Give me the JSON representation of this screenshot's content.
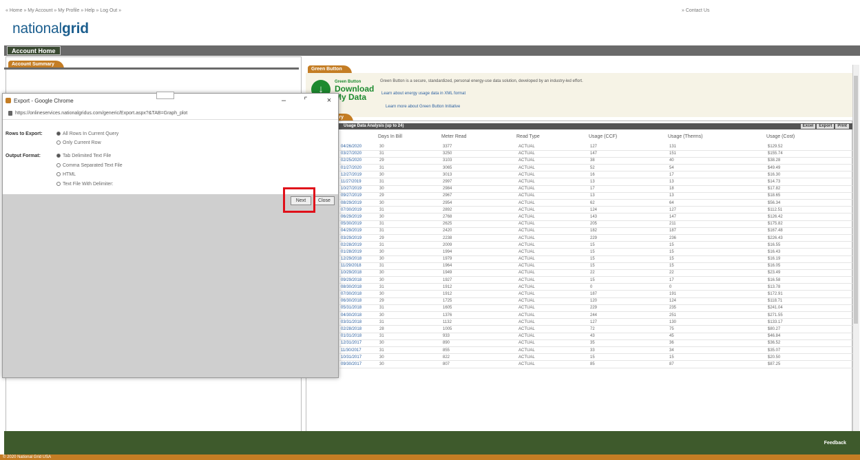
{
  "header": {
    "breadcrumb": "« Home » My Account » My Profile » Help » Log Out »",
    "contact": "» Contact Us",
    "logo_light": "national",
    "logo_bold": "grid"
  },
  "nav": {
    "account_home": "Account Home"
  },
  "account_summary": {
    "tab": "Account Summary"
  },
  "green_button": {
    "tab": "Green Button",
    "icon": "download-arrow-icon",
    "small_label": "Green Button",
    "title_1": "Download",
    "title_2": "My Data",
    "desc": "Green Button is a secure, standardized, personal energy-use data solution, developed by an industry-led effort.",
    "link_1": "Learn about energy usage data in XML format",
    "link_2": "Learn more about Green Button Initiative"
  },
  "usage": {
    "tab": "Usage History",
    "bar_title": "Usage Data Analysis (up to 24)",
    "buttons": [
      "Excel",
      "Export",
      "Print"
    ],
    "columns": [
      "Days In Bill",
      "Meter Read",
      "Read Type",
      "Usage (CCF)",
      "Usage (Therms)",
      "Usage (Cost)"
    ],
    "rows": [
      [
        "04/26/2020",
        "30",
        "3377",
        "ACTUAL",
        "127",
        "131",
        "$129.52"
      ],
      [
        "03/27/2020",
        "31",
        "3250",
        "ACTUAL",
        "147",
        "151",
        "$155.74"
      ],
      [
        "02/25/2020",
        "29",
        "3103",
        "ACTUAL",
        "38",
        "40",
        "$38.28"
      ],
      [
        "01/27/2020",
        "31",
        "3065",
        "ACTUAL",
        "52",
        "54",
        "$49.49"
      ],
      [
        "12/27/2019",
        "30",
        "3013",
        "ACTUAL",
        "16",
        "17",
        "$16.30"
      ],
      [
        "11/27/2019",
        "31",
        "2997",
        "ACTUAL",
        "13",
        "13",
        "$14.73"
      ],
      [
        "10/27/2019",
        "30",
        "2984",
        "ACTUAL",
        "17",
        "18",
        "$17.82"
      ],
      [
        "09/27/2019",
        "29",
        "2967",
        "ACTUAL",
        "13",
        "13",
        "$18.65"
      ],
      [
        "08/29/2019",
        "30",
        "2954",
        "ACTUAL",
        "62",
        "64",
        "$56.34"
      ],
      [
        "07/30/2019",
        "31",
        "2892",
        "ACTUAL",
        "124",
        "127",
        "$112.51"
      ],
      [
        "06/29/2019",
        "30",
        "2768",
        "ACTUAL",
        "143",
        "147",
        "$126.42"
      ],
      [
        "05/30/2019",
        "31",
        "2625",
        "ACTUAL",
        "205",
        "211",
        "$175.82"
      ],
      [
        "04/29/2019",
        "31",
        "2420",
        "ACTUAL",
        "182",
        "187",
        "$167.48"
      ],
      [
        "03/29/2019",
        "29",
        "2238",
        "ACTUAL",
        "229",
        "236",
        "$226.43"
      ],
      [
        "02/28/2019",
        "31",
        "2009",
        "ACTUAL",
        "15",
        "15",
        "$16.55"
      ],
      [
        "01/28/2019",
        "30",
        "1994",
        "ACTUAL",
        "15",
        "15",
        "$16.43"
      ],
      [
        "12/29/2018",
        "30",
        "1979",
        "ACTUAL",
        "15",
        "15",
        "$16.19"
      ],
      [
        "11/29/2018",
        "31",
        "1964",
        "ACTUAL",
        "15",
        "15",
        "$16.05"
      ],
      [
        "10/29/2018",
        "30",
        "1949",
        "ACTUAL",
        "22",
        "22",
        "$23.49"
      ],
      [
        "09/29/2018",
        "30",
        "1927",
        "ACTUAL",
        "15",
        "17",
        "$16.58"
      ],
      [
        "08/30/2018",
        "31",
        "1912",
        "ACTUAL",
        "0",
        "0",
        "$13.78"
      ],
      [
        "07/30/2018",
        "30",
        "1912",
        "ACTUAL",
        "187",
        "191",
        "$172.91"
      ],
      [
        "06/30/2018",
        "29",
        "1725",
        "ACTUAL",
        "120",
        "124",
        "$118.71"
      ],
      [
        "05/31/2018",
        "31",
        "1605",
        "ACTUAL",
        "229",
        "235",
        "$241.04"
      ],
      [
        "04/30/2018",
        "30",
        "1376",
        "ACTUAL",
        "244",
        "251",
        "$271.55"
      ],
      [
        "03/31/2018",
        "31",
        "1132",
        "ACTUAL",
        "127",
        "130",
        "$133.17"
      ],
      [
        "02/28/2018",
        "28",
        "1005",
        "ACTUAL",
        "72",
        "75",
        "$80.27"
      ],
      [
        "01/31/2018",
        "31",
        "933",
        "ACTUAL",
        "43",
        "45",
        "$46.84"
      ],
      [
        "12/31/2017",
        "30",
        "890",
        "ACTUAL",
        "35",
        "36",
        "$36.52"
      ],
      [
        "11/30/2017",
        "31",
        "855",
        "ACTUAL",
        "33",
        "34",
        "$35.07"
      ],
      [
        "10/31/2017",
        "30",
        "822",
        "ACTUAL",
        "15",
        "15",
        "$20.50"
      ],
      [
        "09/30/2017",
        "30",
        "807",
        "ACTUAL",
        "85",
        "87",
        "$87.25"
      ]
    ]
  },
  "popup": {
    "title": "Export - Google Chrome",
    "url": "https://onlineservices.nationalgridus.com/generic/Export.aspx?&TAB=Graph_plot",
    "rows_label": "Rows to Export:",
    "rows_options": [
      "All Rows In Current Query",
      "Only Current Row"
    ],
    "format_label": "Output Format:",
    "format_options": [
      "Tab Delimited Text File",
      "Comma Separated Text File",
      "HTML",
      "Text File With Delimiter:"
    ],
    "next_button": "Next",
    "close_button": "Close"
  },
  "footer": {
    "feedback": "Feedback",
    "bottom": "© 2020 National Grid USA"
  }
}
